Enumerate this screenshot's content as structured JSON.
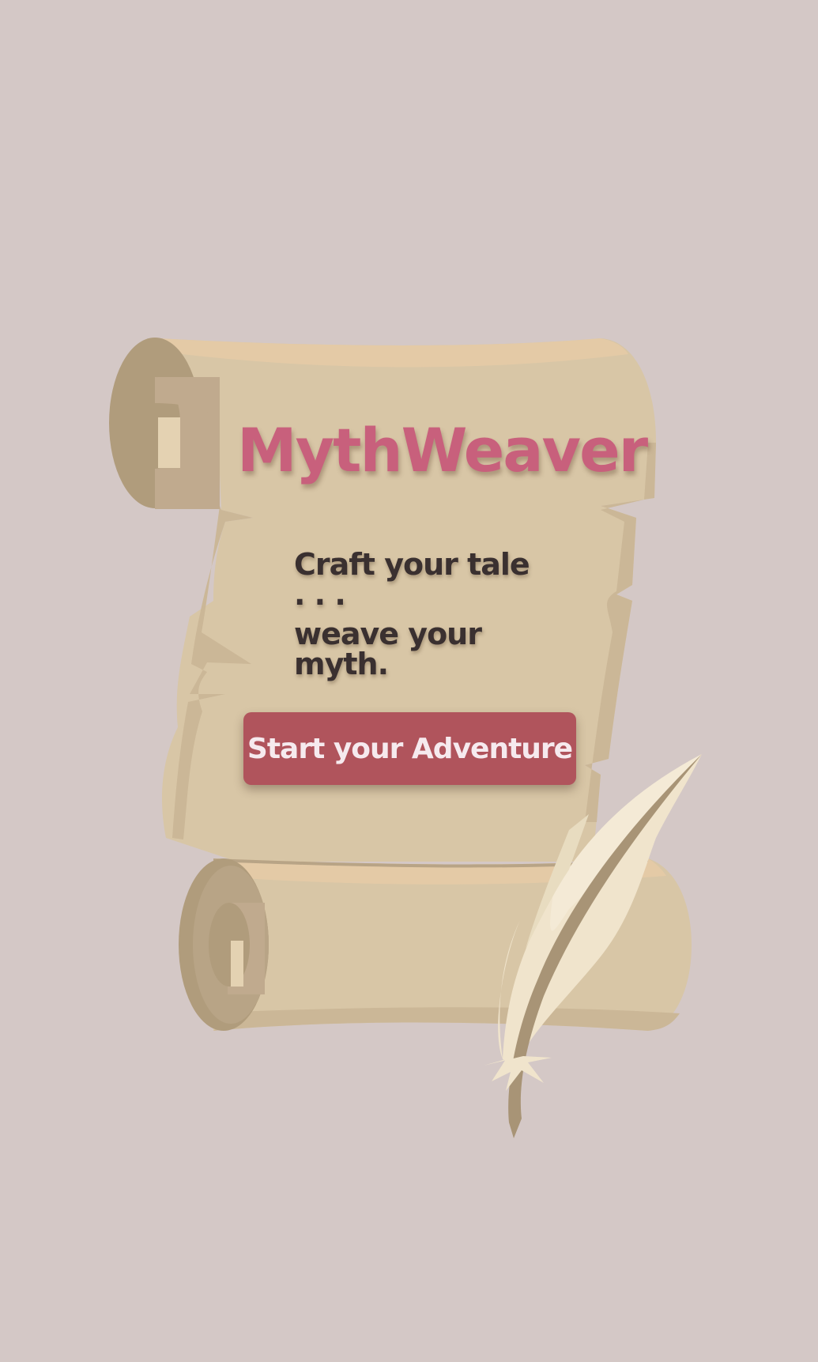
{
  "app": {
    "title": "MythWeaver"
  },
  "tagline": {
    "line1": "Craft your tale . . .",
    "line2": "weave your myth."
  },
  "cta": {
    "label": "Start your Adventure"
  },
  "colors": {
    "background": "#d4c8c6",
    "parchment": "#d8c6a6",
    "parchment_shade": "#cbb797",
    "roll_outer": "#b09c7c",
    "roll_inner": "#c0aa8e",
    "title": "#c8607c",
    "tagline": "#3a3030",
    "button": "#b0545c",
    "button_text": "#f6eaee",
    "quill": "#f0e4cc",
    "quill_shaft": "#a89476"
  },
  "icons": {
    "scroll": "parchment-scroll-icon",
    "quill": "quill-feather-icon"
  }
}
